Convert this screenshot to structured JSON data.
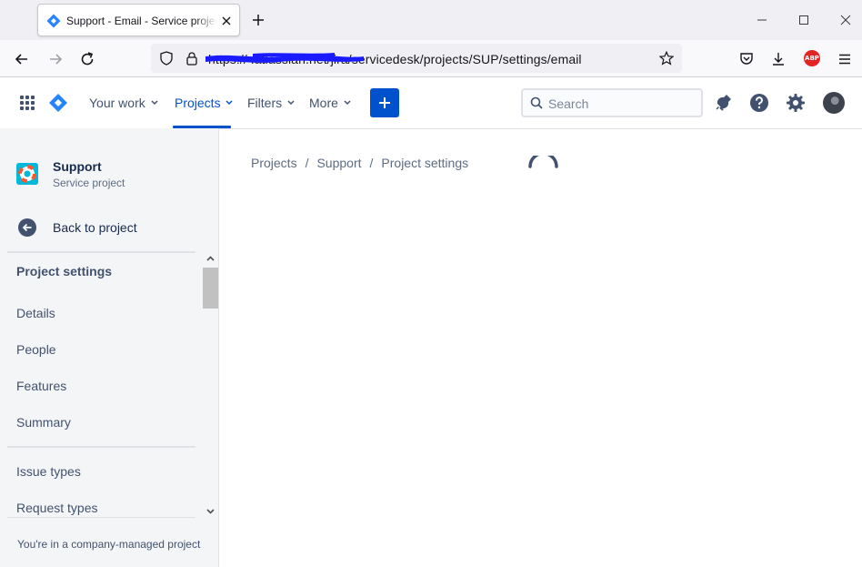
{
  "browser": {
    "tab_title": "Support - Email - Service project",
    "url": "https://                          .atlassian.net/jira/servicedesk/projects/SUP/settings/email",
    "abp_label": "ABP"
  },
  "topnav": {
    "your_work": "Your work",
    "projects": "Projects",
    "filters": "Filters",
    "more": "More",
    "search_placeholder": "Search"
  },
  "sidebar": {
    "project_name": "Support",
    "project_type": "Service project",
    "back_label": "Back to project",
    "heading": "Project settings",
    "items": [
      "Details",
      "People",
      "Features",
      "Summary",
      "Issue types",
      "Request types"
    ],
    "footer": "You're in a company-managed project"
  },
  "breadcrumb": [
    "Projects",
    "Support",
    "Project settings"
  ],
  "colors": {
    "brand": "#0052cc",
    "text": "#172b4d",
    "subtle_text": "#42526e",
    "sidebar_bg": "#f4f5f7",
    "redaction": "#1a1aff"
  },
  "icons": [
    "jira-favicon-icon",
    "close-icon",
    "plus-icon",
    "minimize-icon",
    "maximize-icon",
    "back-arrow-icon",
    "forward-arrow-icon",
    "reload-icon",
    "shield-icon",
    "lock-icon",
    "star-icon",
    "pocket-icon",
    "download-icon",
    "adblock-icon",
    "menu-icon",
    "app-switcher-icon",
    "jira-logo-icon",
    "chevron-down-icon",
    "search-icon",
    "notification-icon",
    "help-icon",
    "settings-icon",
    "loading-spinner-icon"
  ]
}
